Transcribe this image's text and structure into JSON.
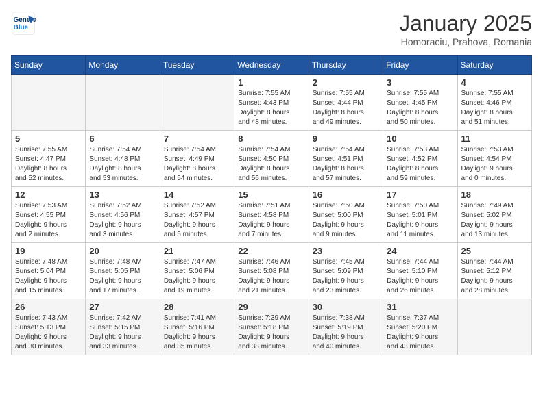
{
  "header": {
    "logo_line1": "General",
    "logo_line2": "Blue",
    "month_title": "January 2025",
    "location": "Homoraciu, Prahova, Romania"
  },
  "weekdays": [
    "Sunday",
    "Monday",
    "Tuesday",
    "Wednesday",
    "Thursday",
    "Friday",
    "Saturday"
  ],
  "weeks": [
    [
      {
        "day": "",
        "info": ""
      },
      {
        "day": "",
        "info": ""
      },
      {
        "day": "",
        "info": ""
      },
      {
        "day": "1",
        "info": "Sunrise: 7:55 AM\nSunset: 4:43 PM\nDaylight: 8 hours\nand 48 minutes."
      },
      {
        "day": "2",
        "info": "Sunrise: 7:55 AM\nSunset: 4:44 PM\nDaylight: 8 hours\nand 49 minutes."
      },
      {
        "day": "3",
        "info": "Sunrise: 7:55 AM\nSunset: 4:45 PM\nDaylight: 8 hours\nand 50 minutes."
      },
      {
        "day": "4",
        "info": "Sunrise: 7:55 AM\nSunset: 4:46 PM\nDaylight: 8 hours\nand 51 minutes."
      }
    ],
    [
      {
        "day": "5",
        "info": "Sunrise: 7:55 AM\nSunset: 4:47 PM\nDaylight: 8 hours\nand 52 minutes."
      },
      {
        "day": "6",
        "info": "Sunrise: 7:54 AM\nSunset: 4:48 PM\nDaylight: 8 hours\nand 53 minutes."
      },
      {
        "day": "7",
        "info": "Sunrise: 7:54 AM\nSunset: 4:49 PM\nDaylight: 8 hours\nand 54 minutes."
      },
      {
        "day": "8",
        "info": "Sunrise: 7:54 AM\nSunset: 4:50 PM\nDaylight: 8 hours\nand 56 minutes."
      },
      {
        "day": "9",
        "info": "Sunrise: 7:54 AM\nSunset: 4:51 PM\nDaylight: 8 hours\nand 57 minutes."
      },
      {
        "day": "10",
        "info": "Sunrise: 7:53 AM\nSunset: 4:52 PM\nDaylight: 8 hours\nand 59 minutes."
      },
      {
        "day": "11",
        "info": "Sunrise: 7:53 AM\nSunset: 4:54 PM\nDaylight: 9 hours\nand 0 minutes."
      }
    ],
    [
      {
        "day": "12",
        "info": "Sunrise: 7:53 AM\nSunset: 4:55 PM\nDaylight: 9 hours\nand 2 minutes."
      },
      {
        "day": "13",
        "info": "Sunrise: 7:52 AM\nSunset: 4:56 PM\nDaylight: 9 hours\nand 3 minutes."
      },
      {
        "day": "14",
        "info": "Sunrise: 7:52 AM\nSunset: 4:57 PM\nDaylight: 9 hours\nand 5 minutes."
      },
      {
        "day": "15",
        "info": "Sunrise: 7:51 AM\nSunset: 4:58 PM\nDaylight: 9 hours\nand 7 minutes."
      },
      {
        "day": "16",
        "info": "Sunrise: 7:50 AM\nSunset: 5:00 PM\nDaylight: 9 hours\nand 9 minutes."
      },
      {
        "day": "17",
        "info": "Sunrise: 7:50 AM\nSunset: 5:01 PM\nDaylight: 9 hours\nand 11 minutes."
      },
      {
        "day": "18",
        "info": "Sunrise: 7:49 AM\nSunset: 5:02 PM\nDaylight: 9 hours\nand 13 minutes."
      }
    ],
    [
      {
        "day": "19",
        "info": "Sunrise: 7:48 AM\nSunset: 5:04 PM\nDaylight: 9 hours\nand 15 minutes."
      },
      {
        "day": "20",
        "info": "Sunrise: 7:48 AM\nSunset: 5:05 PM\nDaylight: 9 hours\nand 17 minutes."
      },
      {
        "day": "21",
        "info": "Sunrise: 7:47 AM\nSunset: 5:06 PM\nDaylight: 9 hours\nand 19 minutes."
      },
      {
        "day": "22",
        "info": "Sunrise: 7:46 AM\nSunset: 5:08 PM\nDaylight: 9 hours\nand 21 minutes."
      },
      {
        "day": "23",
        "info": "Sunrise: 7:45 AM\nSunset: 5:09 PM\nDaylight: 9 hours\nand 23 minutes."
      },
      {
        "day": "24",
        "info": "Sunrise: 7:44 AM\nSunset: 5:10 PM\nDaylight: 9 hours\nand 26 minutes."
      },
      {
        "day": "25",
        "info": "Sunrise: 7:44 AM\nSunset: 5:12 PM\nDaylight: 9 hours\nand 28 minutes."
      }
    ],
    [
      {
        "day": "26",
        "info": "Sunrise: 7:43 AM\nSunset: 5:13 PM\nDaylight: 9 hours\nand 30 minutes."
      },
      {
        "day": "27",
        "info": "Sunrise: 7:42 AM\nSunset: 5:15 PM\nDaylight: 9 hours\nand 33 minutes."
      },
      {
        "day": "28",
        "info": "Sunrise: 7:41 AM\nSunset: 5:16 PM\nDaylight: 9 hours\nand 35 minutes."
      },
      {
        "day": "29",
        "info": "Sunrise: 7:39 AM\nSunset: 5:18 PM\nDaylight: 9 hours\nand 38 minutes."
      },
      {
        "day": "30",
        "info": "Sunrise: 7:38 AM\nSunset: 5:19 PM\nDaylight: 9 hours\nand 40 minutes."
      },
      {
        "day": "31",
        "info": "Sunrise: 7:37 AM\nSunset: 5:20 PM\nDaylight: 9 hours\nand 43 minutes."
      },
      {
        "day": "",
        "info": ""
      }
    ]
  ]
}
